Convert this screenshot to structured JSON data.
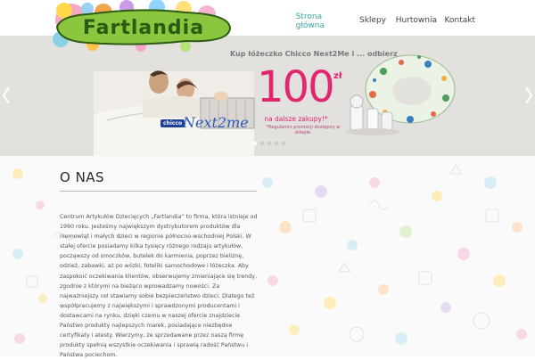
{
  "header": {
    "logo_text": "Fartlandia",
    "nav": [
      {
        "label_line1": "Strona",
        "label_line2": "główna",
        "active": true
      },
      {
        "label": "Sklepy"
      },
      {
        "label": "Hurtownia"
      },
      {
        "label": "Kontakt"
      }
    ]
  },
  "banner": {
    "promo_title": "Kup łóżeczko Chicco Next2Me i ... odbierz",
    "amount": "100",
    "currency": "zł",
    "subline": "na dalsze zakupy!*",
    "note": "*Regulamin promocji dostępny w sklepie.",
    "brand": "chicco",
    "product": "Next2me",
    "slides_total": 5,
    "active_slide": 0
  },
  "main": {
    "heading": "O NAS",
    "paragraph": "Centrum Artykułów Dziecięcych „Fartlandia” to firma, która istnieje od 1990 roku. Jesteśmy największym dystrybutorem produktów dla niemowląt i małych dzieci w regionie północno-wschodniej Polski. W stałej ofercie posiadamy kilka tysięcy różnego rodzaju artykułów, począwszy od smoczków, butelek do karmienia, poprzez bieliznę, odzież, zabawki, aż po wózki, foteliki samochodowe i łóżeczka. Aby zaspokoić oczekiwania klientów, obserwujemy zmieniające się trendy, zgodnie z którymi na bieżąco wprowadzamy nowości. Za najważniejszy cel stawiamy sobie bezpieczeństwo dzieci. Dlatego też współpracujemy z największymi i sprawdzonymi producentami i dostawcami na rynku, dzięki czemu w naszej ofercie znajdziecie Państwo produkty najlepszych marek, posiadające niezbędne certyfikaty i atesty. Wierzymy, że sprzedawane przez naszą firmę produkty spełnią wszystkie oczekiwania i sprawią radość Państwu i Państwa pociechom."
  },
  "colors": {
    "accent": "#3aa6a0",
    "promo_pink": "#e0266e",
    "logo_green": "#8cc63f",
    "banner_bg": "#e3e1dd"
  }
}
